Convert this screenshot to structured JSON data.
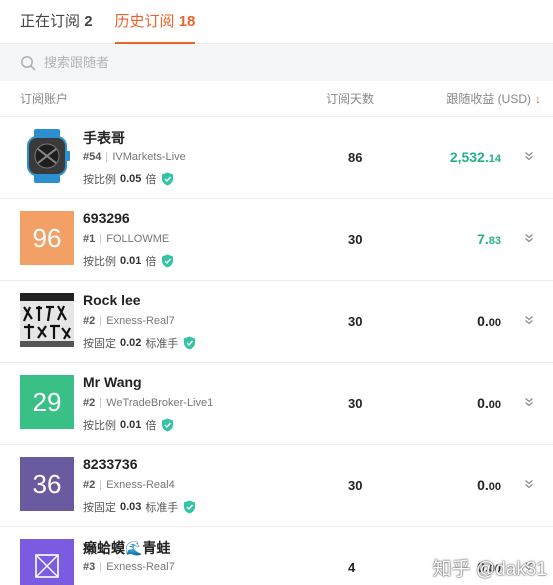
{
  "tabs": [
    {
      "label": "正在订阅",
      "count": "2"
    },
    {
      "label": "历史订阅",
      "count": "18"
    }
  ],
  "search": {
    "placeholder": "搜索跟随者"
  },
  "columns": {
    "account": "订阅账户",
    "days": "订阅天数",
    "profit": "跟随收益 (USD)",
    "sort_arrow": "↓"
  },
  "colors": {
    "accent": "#e8642c",
    "positive": "#23b08b",
    "shield": "#33c4a4"
  },
  "rows": [
    {
      "name": "手表哥",
      "rank": "#54",
      "broker": "IVMarkets-Live",
      "mode_prefix": "按比例",
      "mode_value": "0.05",
      "mode_suffix": "倍",
      "days": "86",
      "profit_int": "2,532.",
      "profit_dec": "14",
      "positive": true,
      "avatar": {
        "type": "image",
        "icon": "watch-image"
      }
    },
    {
      "name": "693296",
      "rank": "#1",
      "broker": "FOLLOWME",
      "mode_prefix": "按比例",
      "mode_value": "0.01",
      "mode_suffix": "倍",
      "days": "30",
      "profit_int": "7.",
      "profit_dec": "83",
      "positive": true,
      "avatar": {
        "type": "number",
        "text": "96",
        "color": "#f2a066"
      }
    },
    {
      "name": "Rock lee",
      "rank": "#2",
      "broker": "Exness-Real7",
      "mode_prefix": "按固定",
      "mode_value": "0.02",
      "mode_suffix": "标准手",
      "days": "30",
      "profit_int": "0.",
      "profit_dec": "00",
      "positive": false,
      "avatar": {
        "type": "image",
        "icon": "calligraphy-image"
      }
    },
    {
      "name": "Mr Wang",
      "rank": "#2",
      "broker": "WeTradeBroker-Live1",
      "mode_prefix": "按比例",
      "mode_value": "0.01",
      "mode_suffix": "倍",
      "days": "30",
      "profit_int": "0.",
      "profit_dec": "00",
      "positive": false,
      "avatar": {
        "type": "number",
        "text": "29",
        "color": "#38c087"
      }
    },
    {
      "name": "8233736",
      "rank": "#2",
      "broker": "Exness-Real4",
      "mode_prefix": "按固定",
      "mode_value": "0.03",
      "mode_suffix": "标准手",
      "days": "30",
      "profit_int": "0.",
      "profit_dec": "00",
      "positive": false,
      "avatar": {
        "type": "number",
        "text": "36",
        "color": "#6a5aa0"
      }
    },
    {
      "name": "癞蛤蟆🌊青蛙",
      "rank": "#3",
      "broker": "Exness-Real7",
      "mode_prefix": "",
      "mode_value": "",
      "mode_suffix": "",
      "days": "4",
      "profit_int": "0.",
      "profit_dec": "00",
      "positive": false,
      "avatar": {
        "type": "image",
        "icon": "broken-image",
        "color": "#7b5ce0"
      }
    }
  ],
  "watermark": "知乎 @dak31"
}
